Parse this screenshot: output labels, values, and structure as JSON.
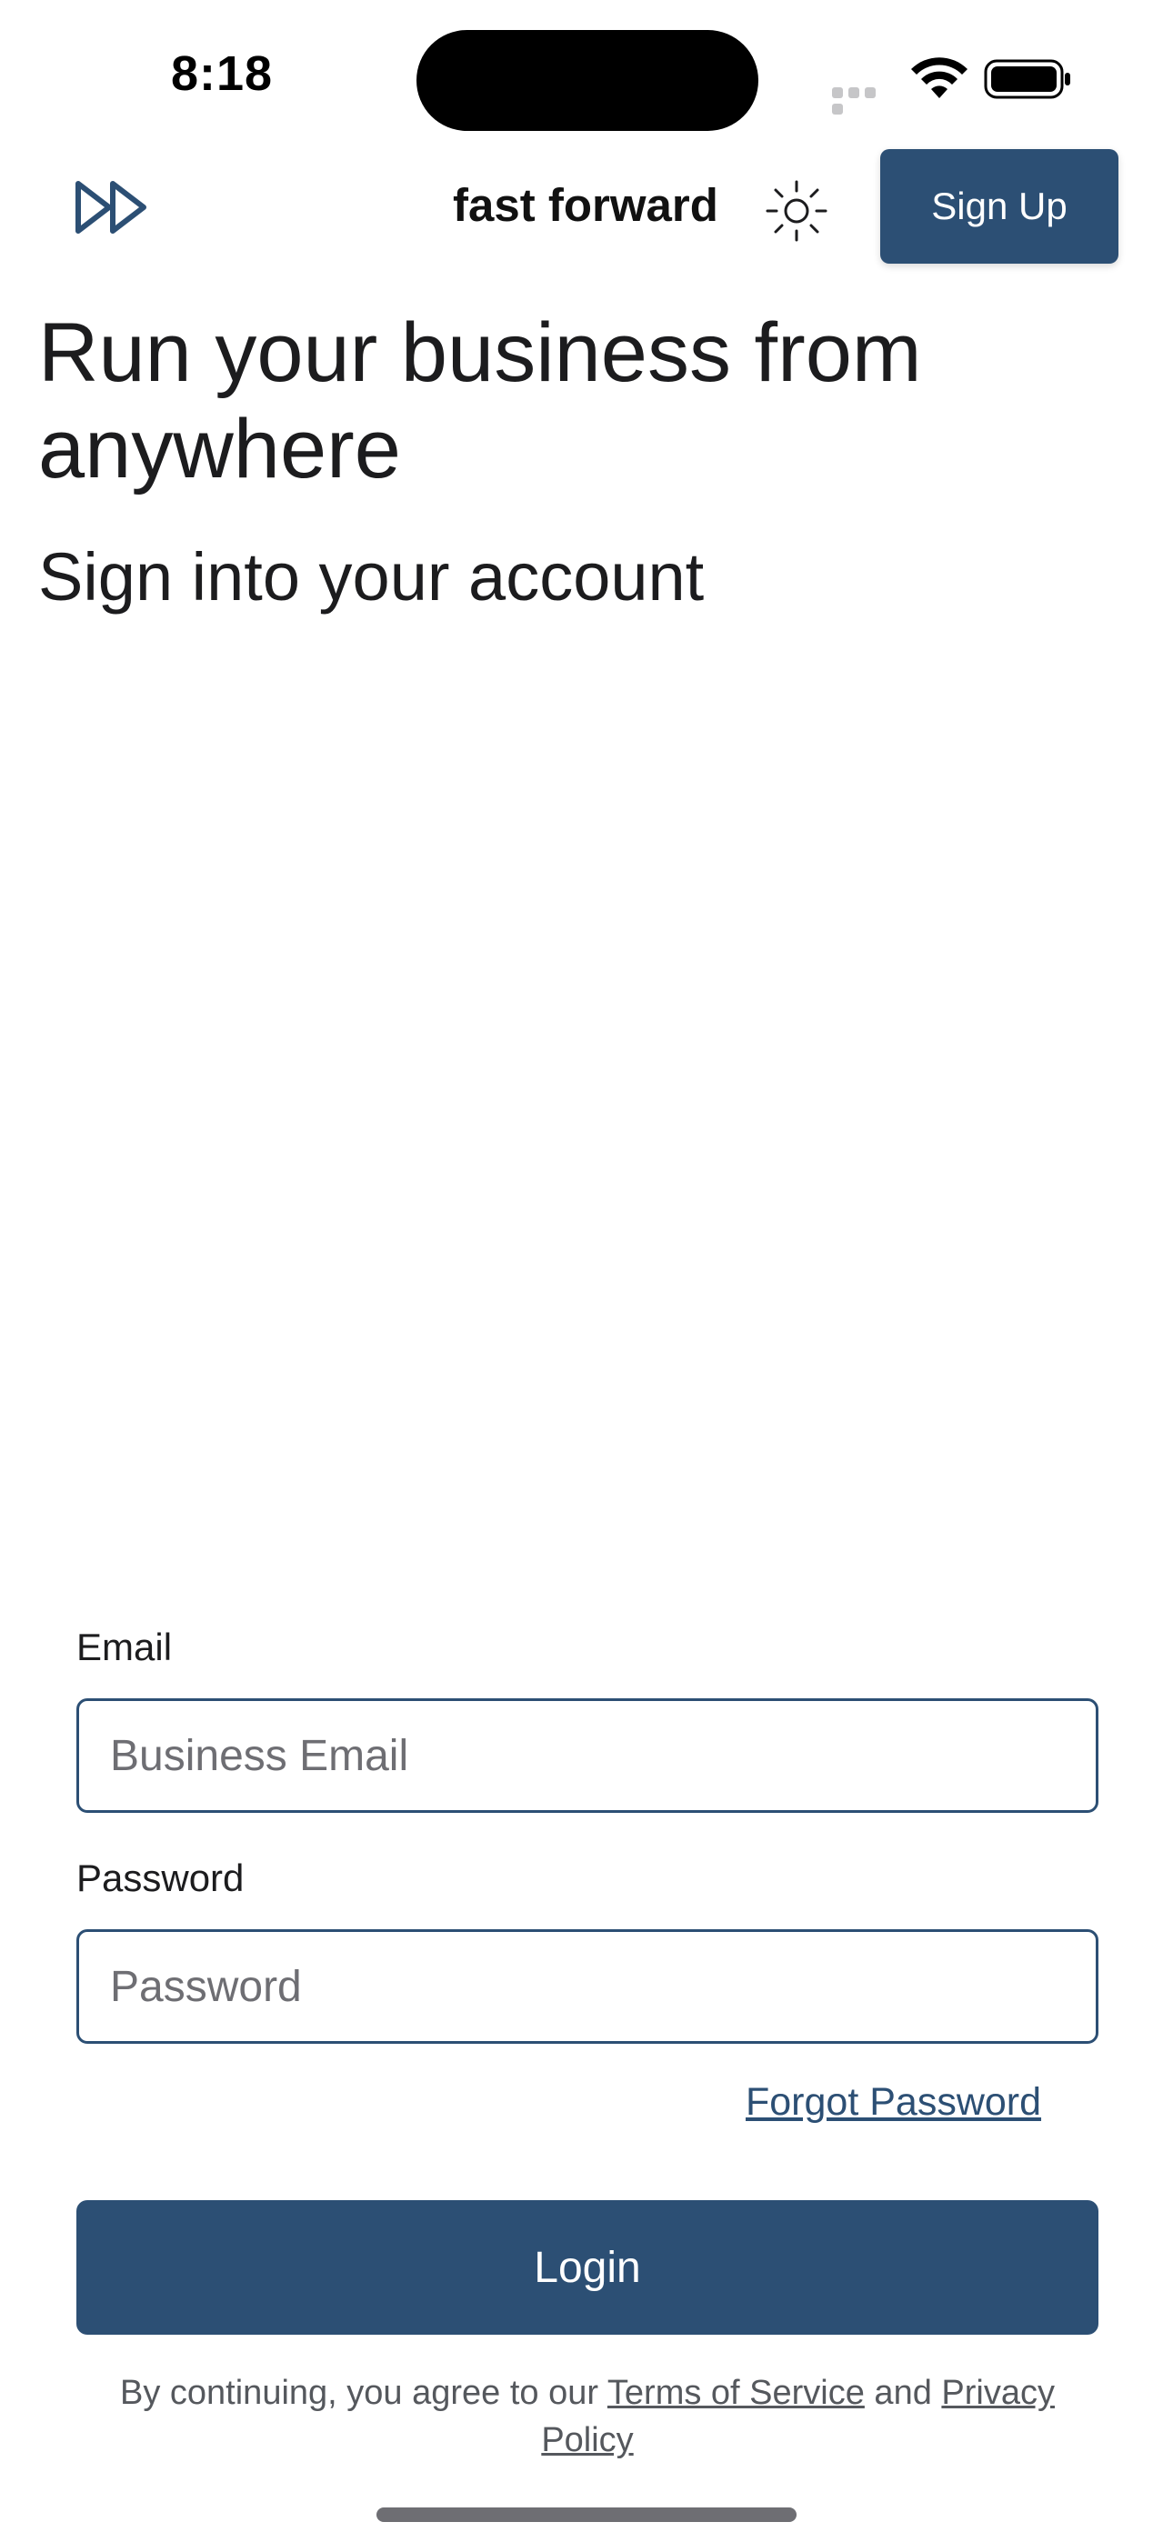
{
  "status_bar": {
    "time": "8:18"
  },
  "nav": {
    "brand": "fast forward",
    "signup_label": "Sign Up",
    "logo_icon": "fast-forward-icon",
    "theme_icon": "sun-icon"
  },
  "hero": {
    "title": "Run your business from anywhere",
    "subtitle": "Sign into your account"
  },
  "form": {
    "email_label": "Email",
    "email_placeholder": "Business Email",
    "email_value": "",
    "password_label": "Password",
    "password_placeholder": "Password",
    "password_value": "",
    "forgot_label": "Forgot Password",
    "login_label": "Login"
  },
  "legal": {
    "prefix": "By continuing, you agree to our ",
    "terms": "Terms of Service",
    "middle": " and ",
    "privacy": "Privacy Policy"
  },
  "colors": {
    "accent": "#2c4f74",
    "text": "#1c1c1e",
    "muted": "#6e6e73"
  }
}
